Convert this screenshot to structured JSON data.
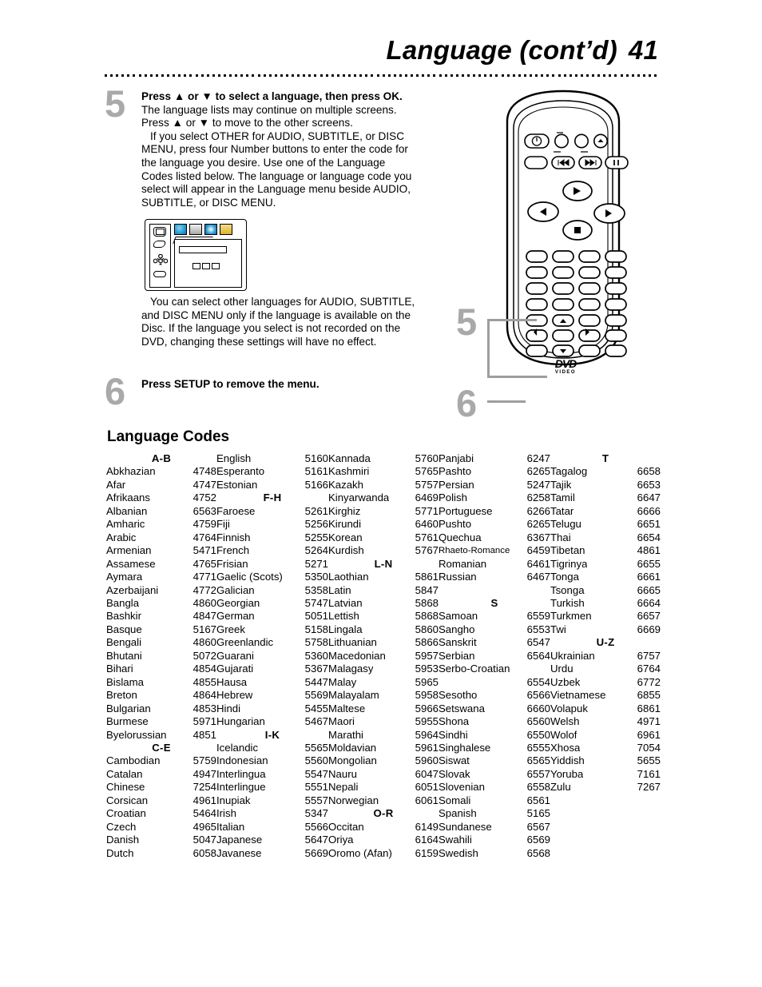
{
  "header": {
    "title": "Language (cont’d)",
    "page_number": "41"
  },
  "steps": [
    {
      "number": "5",
      "paragraphs": [
        "Press ▲ or ▼ to select a language, then press OK.",
        " The language lists may continue on multiple screens. Press ▲ or ▼ to move to the other screens.",
        "If you select OTHER for AUDIO, SUBTITLE, or DISC MENU, press four Number buttons to enter the code for the language you desire. Use one of the Language Codes listed below. The language or language code you select will appear in the Language menu beside AUDIO, SUBTITLE, or DISC MENU."
      ]
    },
    {
      "number": "6",
      "bold_lead": "Press SETUP",
      "rest": " to remove the menu."
    }
  ],
  "note": "You can select other languages for AUDIO, SUBTITLE, and DISC MENU only if the language is available on the Disc. If the language you select is not recorded on the DVD, changing these settings will have no effect.",
  "remote": {
    "callout_5": "5",
    "callout_6": "6",
    "logo_main": "DVD",
    "logo_sub": "VIDEO"
  },
  "language_codes": {
    "title": "Language Codes",
    "columns": [
      {
        "entries": [
          {
            "type": "header",
            "label": "A-B"
          },
          {
            "type": "row",
            "name": "Abkhazian",
            "code": "4748"
          },
          {
            "type": "row",
            "name": "Afar",
            "code": "4747"
          },
          {
            "type": "row",
            "name": "Afrikaans",
            "code": "4752"
          },
          {
            "type": "row",
            "name": "Albanian",
            "code": "6563"
          },
          {
            "type": "row",
            "name": "Amharic",
            "code": "4759"
          },
          {
            "type": "row",
            "name": "Arabic",
            "code": "4764"
          },
          {
            "type": "row",
            "name": "Armenian",
            "code": "5471"
          },
          {
            "type": "row",
            "name": "Assamese",
            "code": "4765"
          },
          {
            "type": "row",
            "name": "Aymara",
            "code": "4771"
          },
          {
            "type": "row",
            "name": "Azerbaijani",
            "code": "4772"
          },
          {
            "type": "row",
            "name": "Bangla",
            "code": "4860"
          },
          {
            "type": "row",
            "name": "Bashkir",
            "code": "4847"
          },
          {
            "type": "row",
            "name": "Basque",
            "code": "5167"
          },
          {
            "type": "row",
            "name": "Bengali",
            "code": "4860"
          },
          {
            "type": "row",
            "name": "Bhutani",
            "code": "5072"
          },
          {
            "type": "row",
            "name": "Bihari",
            "code": "4854"
          },
          {
            "type": "row",
            "name": "Bislama",
            "code": "4855"
          },
          {
            "type": "row",
            "name": "Breton",
            "code": "4864"
          },
          {
            "type": "row",
            "name": "Bulgarian",
            "code": "4853"
          },
          {
            "type": "row",
            "name": "Burmese",
            "code": "5971"
          },
          {
            "type": "row",
            "name": "Byelorussian",
            "code": "4851"
          },
          {
            "type": "header",
            "label": "C-E"
          },
          {
            "type": "row",
            "name": "Cambodian",
            "code": "5759"
          },
          {
            "type": "row",
            "name": "Catalan",
            "code": "4947"
          },
          {
            "type": "row",
            "name": "Chinese",
            "code": "7254"
          },
          {
            "type": "row",
            "name": "Corsican",
            "code": "4961"
          },
          {
            "type": "row",
            "name": "Croatian",
            "code": "5464"
          },
          {
            "type": "row",
            "name": "Czech",
            "code": "4965"
          },
          {
            "type": "row",
            "name": "Danish",
            "code": "5047"
          },
          {
            "type": "row",
            "name": "Dutch",
            "code": "6058"
          }
        ]
      },
      {
        "entries": [
          {
            "type": "row",
            "name": "English",
            "code": "5160"
          },
          {
            "type": "row",
            "name": "Esperanto",
            "code": "5161"
          },
          {
            "type": "row",
            "name": "Estonian",
            "code": "5166"
          },
          {
            "type": "header",
            "label": "F-H"
          },
          {
            "type": "row",
            "name": "Faroese",
            "code": "5261"
          },
          {
            "type": "row",
            "name": "Fiji",
            "code": "5256"
          },
          {
            "type": "row",
            "name": "Finnish",
            "code": "5255"
          },
          {
            "type": "row",
            "name": "French",
            "code": "5264"
          },
          {
            "type": "row",
            "name": "Frisian",
            "code": "5271"
          },
          {
            "type": "row",
            "name": "Gaelic (Scots)",
            "code": "5350"
          },
          {
            "type": "row",
            "name": "Galician",
            "code": "5358"
          },
          {
            "type": "row",
            "name": "Georgian",
            "code": "5747"
          },
          {
            "type": "row",
            "name": "German",
            "code": "5051"
          },
          {
            "type": "row",
            "name": "Greek",
            "code": "5158"
          },
          {
            "type": "row",
            "name": "Greenlandic",
            "code": "5758"
          },
          {
            "type": "row",
            "name": "Guarani",
            "code": "5360"
          },
          {
            "type": "row",
            "name": "Gujarati",
            "code": "5367"
          },
          {
            "type": "row",
            "name": "Hausa",
            "code": "5447"
          },
          {
            "type": "row",
            "name": "Hebrew",
            "code": "5569"
          },
          {
            "type": "row",
            "name": "Hindi",
            "code": "5455"
          },
          {
            "type": "row",
            "name": "Hungarian",
            "code": "5467"
          },
          {
            "type": "header",
            "label": "I-K"
          },
          {
            "type": "row",
            "name": "Icelandic",
            "code": "5565"
          },
          {
            "type": "row",
            "name": "Indonesian",
            "code": "5560"
          },
          {
            "type": "row",
            "name": "Interlingua",
            "code": "5547"
          },
          {
            "type": "row",
            "name": "Interlingue",
            "code": "5551"
          },
          {
            "type": "row",
            "name": "Inupiak",
            "code": "5557"
          },
          {
            "type": "row",
            "name": "Irish",
            "code": "5347"
          },
          {
            "type": "row",
            "name": "Italian",
            "code": "5566"
          },
          {
            "type": "row",
            "name": "Japanese",
            "code": "5647"
          },
          {
            "type": "row",
            "name": "Javanese",
            "code": "5669"
          }
        ]
      },
      {
        "entries": [
          {
            "type": "row",
            "name": "Kannada",
            "code": "5760"
          },
          {
            "type": "row",
            "name": "Kashmiri",
            "code": "5765"
          },
          {
            "type": "row",
            "name": "Kazakh",
            "code": "5757"
          },
          {
            "type": "row",
            "name": "Kinyarwanda",
            "code": "6469"
          },
          {
            "type": "row",
            "name": "Kirghiz",
            "code": "5771"
          },
          {
            "type": "row",
            "name": "Kirundi",
            "code": "6460"
          },
          {
            "type": "row",
            "name": "Korean",
            "code": "5761"
          },
          {
            "type": "row",
            "name": "Kurdish",
            "code": "5767"
          },
          {
            "type": "header",
            "label": "L-N"
          },
          {
            "type": "row",
            "name": "Laothian",
            "code": "5861"
          },
          {
            "type": "row",
            "name": "Latin",
            "code": "5847"
          },
          {
            "type": "row",
            "name": "Latvian",
            "code": "5868"
          },
          {
            "type": "row",
            "name": "Lettish",
            "code": "5868"
          },
          {
            "type": "row",
            "name": "Lingala",
            "code": "5860"
          },
          {
            "type": "row",
            "name": "Lithuanian",
            "code": "5866"
          },
          {
            "type": "row",
            "name": "Macedonian",
            "code": "5957"
          },
          {
            "type": "row",
            "name": "Malagasy",
            "code": "5953"
          },
          {
            "type": "row",
            "name": "Malay",
            "code": "5965"
          },
          {
            "type": "row",
            "name": "Malayalam",
            "code": "5958"
          },
          {
            "type": "row",
            "name": "Maltese",
            "code": "5966"
          },
          {
            "type": "row",
            "name": "Maori",
            "code": "5955"
          },
          {
            "type": "row",
            "name": "Marathi",
            "code": "5964"
          },
          {
            "type": "row",
            "name": "Moldavian",
            "code": "5961"
          },
          {
            "type": "row",
            "name": "Mongolian",
            "code": "5960"
          },
          {
            "type": "row",
            "name": "Nauru",
            "code": "6047"
          },
          {
            "type": "row",
            "name": "Nepali",
            "code": "6051"
          },
          {
            "type": "row",
            "name": "Norwegian",
            "code": "6061"
          },
          {
            "type": "header",
            "label": "O-R"
          },
          {
            "type": "row",
            "name": "Occitan",
            "code": "6149"
          },
          {
            "type": "row",
            "name": "Oriya",
            "code": "6164"
          },
          {
            "type": "row",
            "name": "Oromo (Afan)",
            "code": "6159"
          }
        ]
      },
      {
        "entries": [
          {
            "type": "row",
            "name": "Panjabi",
            "code": "6247"
          },
          {
            "type": "row",
            "name": "Pashto",
            "code": "6265"
          },
          {
            "type": "row",
            "name": "Persian",
            "code": "5247"
          },
          {
            "type": "row",
            "name": "Polish",
            "code": "6258"
          },
          {
            "type": "row",
            "name": "Portuguese",
            "code": "6266"
          },
          {
            "type": "row",
            "name": "Pushto",
            "code": "6265"
          },
          {
            "type": "row",
            "name": "Quechua",
            "code": "6367"
          },
          {
            "type": "row",
            "name": "Rhaeto-Romance",
            "code": "6459",
            "small": true
          },
          {
            "type": "row",
            "name": "Romanian",
            "code": "6461"
          },
          {
            "type": "row",
            "name": "Russian",
            "code": "6467"
          },
          {
            "type": "blank"
          },
          {
            "type": "header",
            "label": "S"
          },
          {
            "type": "row",
            "name": "Samoan",
            "code": "6559"
          },
          {
            "type": "row",
            "name": "Sangho",
            "code": "6553"
          },
          {
            "type": "row",
            "name": "Sanskrit",
            "code": "6547"
          },
          {
            "type": "row",
            "name": "Serbian",
            "code": "6564"
          },
          {
            "type": "wrap",
            "name": "Serbo-Croatian",
            "code": "6554"
          },
          {
            "type": "row",
            "name": "Sesotho",
            "code": "6566"
          },
          {
            "type": "row",
            "name": "Setswana",
            "code": "6660"
          },
          {
            "type": "row",
            "name": "Shona",
            "code": "6560"
          },
          {
            "type": "row",
            "name": "Sindhi",
            "code": "6550"
          },
          {
            "type": "row",
            "name": "Singhalese",
            "code": "6555"
          },
          {
            "type": "row",
            "name": "Siswat",
            "code": "6565"
          },
          {
            "type": "row",
            "name": "Slovak",
            "code": "6557"
          },
          {
            "type": "row",
            "name": "Slovenian",
            "code": "6558"
          },
          {
            "type": "row",
            "name": "Somali",
            "code": "6561"
          },
          {
            "type": "row",
            "name": "Spanish",
            "code": "5165"
          },
          {
            "type": "row",
            "name": "Sundanese",
            "code": "6567"
          },
          {
            "type": "row",
            "name": "Swahili",
            "code": "6569"
          },
          {
            "type": "row",
            "name": "Swedish",
            "code": "6568"
          }
        ]
      },
      {
        "entries": [
          {
            "type": "header",
            "label": "T"
          },
          {
            "type": "row",
            "name": "Tagalog",
            "code": "6658"
          },
          {
            "type": "row",
            "name": "Tajik",
            "code": "6653"
          },
          {
            "type": "row",
            "name": "Tamil",
            "code": "6647"
          },
          {
            "type": "row",
            "name": "Tatar",
            "code": "6666"
          },
          {
            "type": "row",
            "name": "Telugu",
            "code": "6651"
          },
          {
            "type": "row",
            "name": "Thai",
            "code": "6654"
          },
          {
            "type": "row",
            "name": "Tibetan",
            "code": "4861"
          },
          {
            "type": "row",
            "name": "Tigrinya",
            "code": "6655"
          },
          {
            "type": "row",
            "name": "Tonga",
            "code": "6661"
          },
          {
            "type": "row",
            "name": "Tsonga",
            "code": "6665"
          },
          {
            "type": "row",
            "name": "Turkish",
            "code": "6664"
          },
          {
            "type": "row",
            "name": "Turkmen",
            "code": "6657"
          },
          {
            "type": "row",
            "name": "Twi",
            "code": "6669"
          },
          {
            "type": "header",
            "label": "U-Z"
          },
          {
            "type": "row",
            "name": "Ukrainian",
            "code": "6757"
          },
          {
            "type": "row",
            "name": "Urdu",
            "code": "6764"
          },
          {
            "type": "row",
            "name": "Uzbek",
            "code": "6772"
          },
          {
            "type": "row",
            "name": "Vietnamese",
            "code": "6855"
          },
          {
            "type": "row",
            "name": "Volapuk",
            "code": "6861"
          },
          {
            "type": "row",
            "name": "Welsh",
            "code": "4971"
          },
          {
            "type": "row",
            "name": "Wolof",
            "code": "6961"
          },
          {
            "type": "row",
            "name": "Xhosa",
            "code": "7054"
          },
          {
            "type": "row",
            "name": "Yiddish",
            "code": "5655"
          },
          {
            "type": "row",
            "name": "Yoruba",
            "code": "7161"
          },
          {
            "type": "row",
            "name": "Zulu",
            "code": "7267"
          }
        ]
      }
    ]
  },
  "colors": {
    "step_number_gray": "#a9a9a9",
    "tab_blue": "#2f9fd8",
    "tab_gray": "#bdbdbd",
    "tab_yellow": "#e8c33a"
  }
}
